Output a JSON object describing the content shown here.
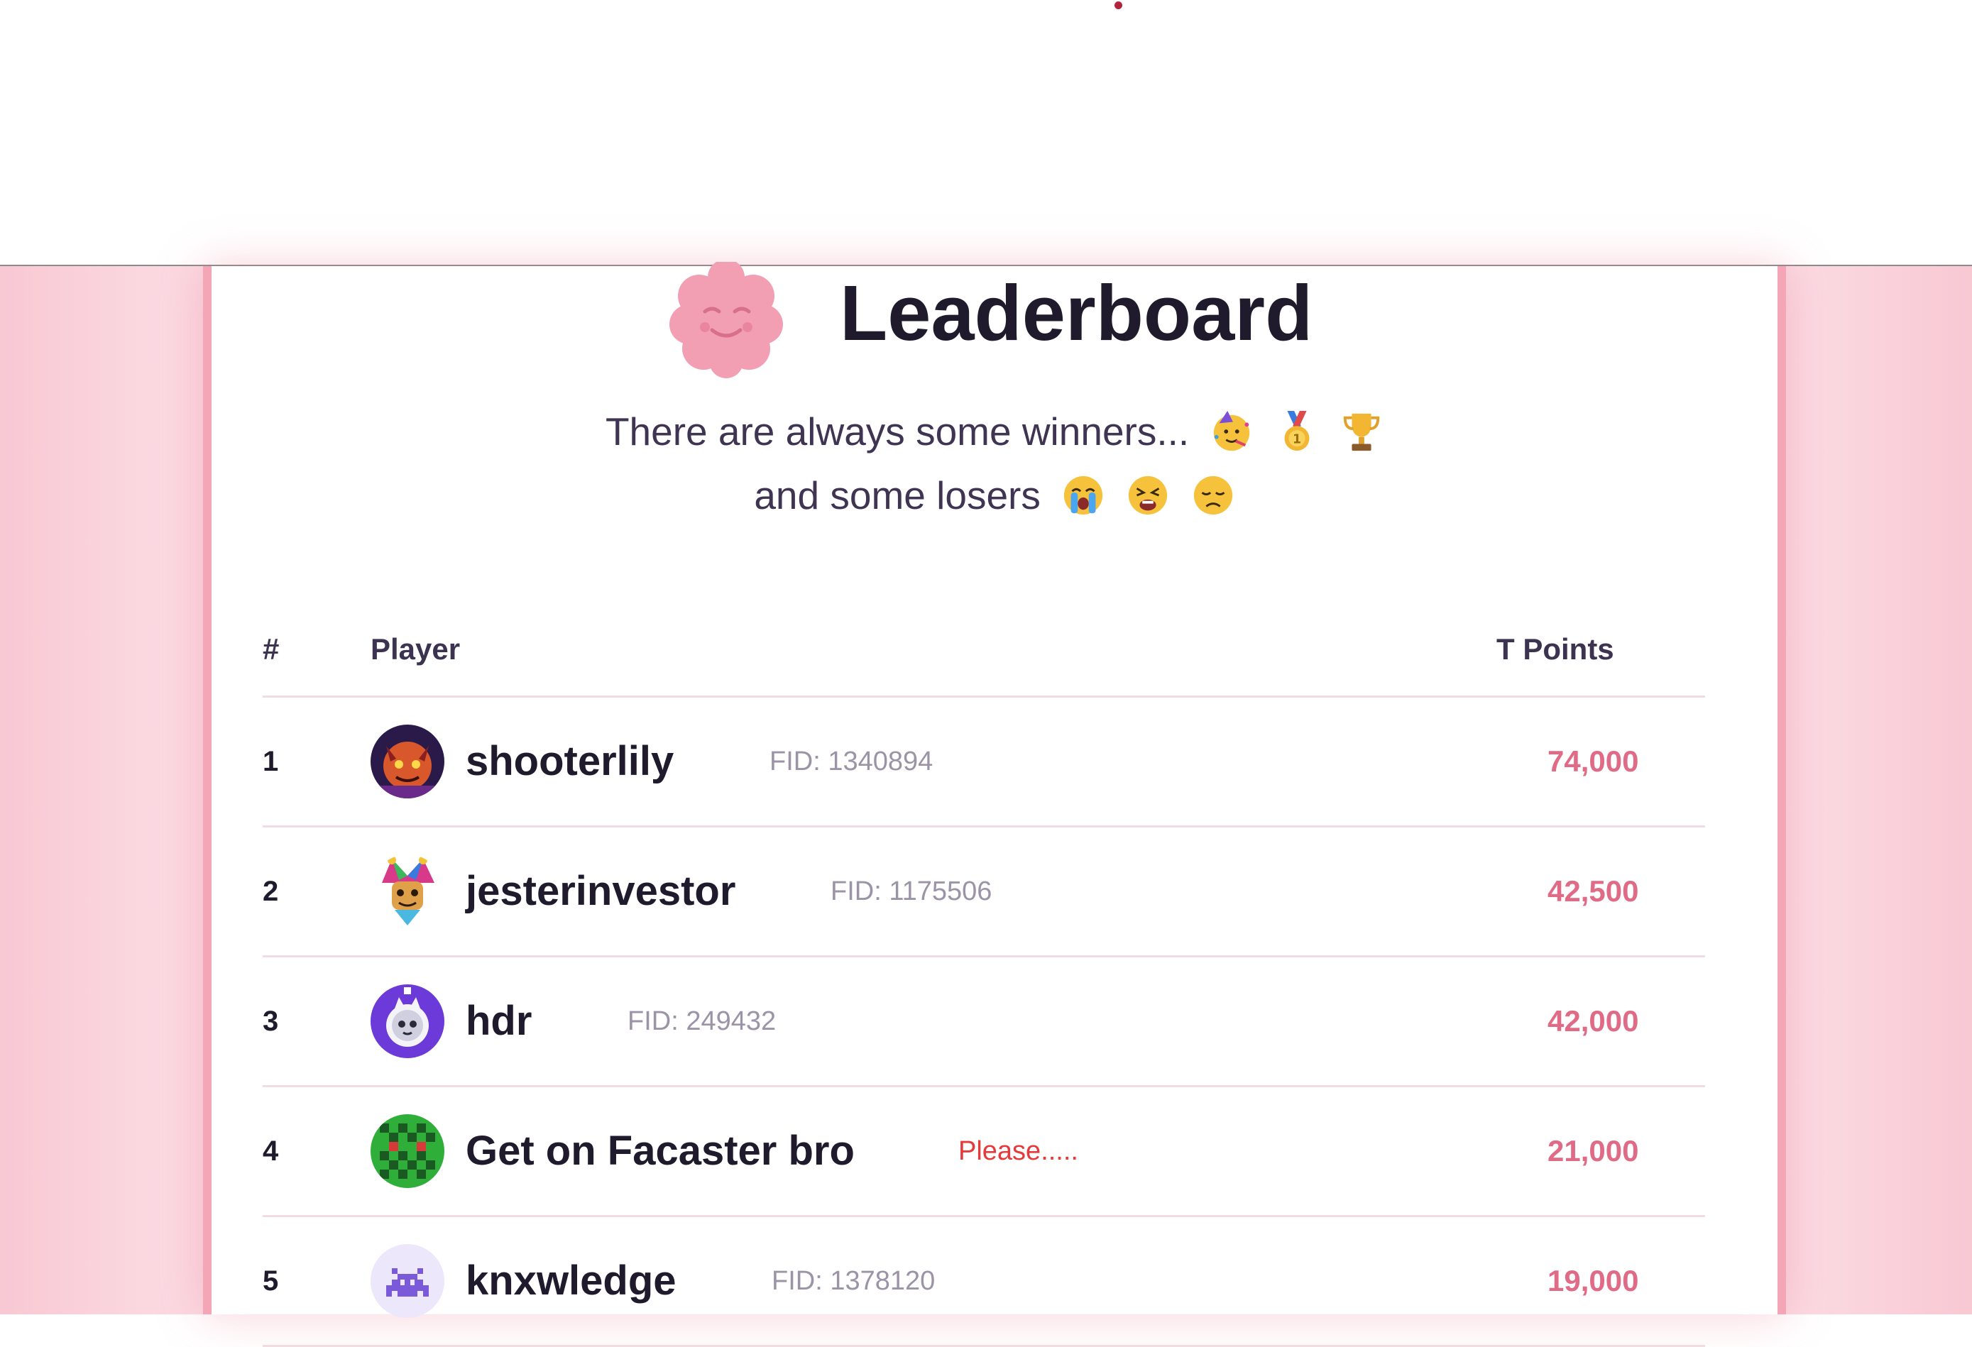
{
  "header": {
    "title": "Leaderboard",
    "tagline_line1": "There are always some winners...",
    "tagline_line2": "and some losers",
    "winner_emojis": [
      "partying-face",
      "gold-medal",
      "trophy"
    ],
    "loser_emojis": [
      "loudly-crying-face",
      "weary-face",
      "disappointed-face"
    ]
  },
  "table": {
    "columns": {
      "rank": "#",
      "player": "Player",
      "points": "T Points"
    },
    "rows": [
      {
        "rank": "1",
        "name": "shooterlily",
        "meta": "FID: 1340894",
        "points": "74,000"
      },
      {
        "rank": "2",
        "name": "jesterinvestor",
        "meta": "FID: 1175506",
        "points": "42,500"
      },
      {
        "rank": "3",
        "name": "hdr",
        "meta": "FID: 249432",
        "points": "42,000"
      },
      {
        "rank": "4",
        "name": "Get on Facaster bro",
        "meta": "Please.....",
        "points": "21,000"
      },
      {
        "rank": "5",
        "name": "knxwledge",
        "meta": "FID: 1378120",
        "points": "19,000"
      }
    ]
  },
  "colors": {
    "accent_pink": "#f4a6b7",
    "points": "#e06b86",
    "title": "#1f1a2c",
    "warning_text": "#e63a3a"
  }
}
